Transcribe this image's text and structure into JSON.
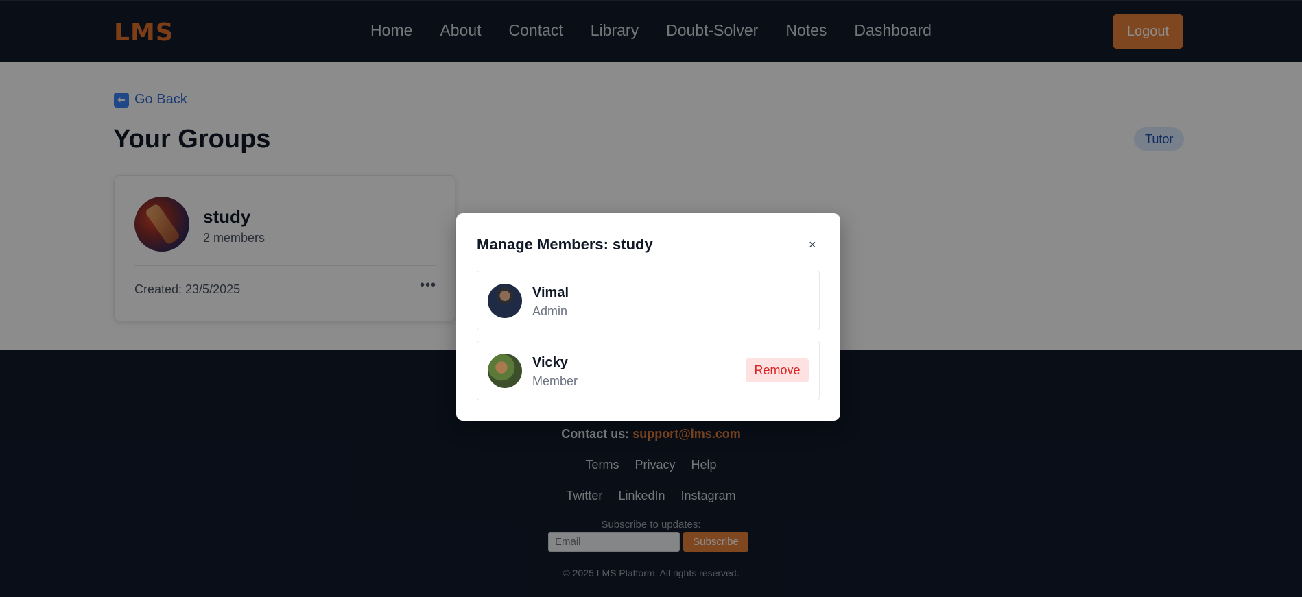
{
  "navbar": {
    "logo": "LMS",
    "links": [
      "Home",
      "About",
      "Contact",
      "Library",
      "Doubt-Solver",
      "Notes",
      "Dashboard"
    ],
    "logout_label": "Logout"
  },
  "main": {
    "back_label": "Go Back",
    "title": "Your Groups",
    "role_badge": "Tutor",
    "group": {
      "name": "study",
      "members": "2 members",
      "created": "Created: 23/5/2025",
      "more_label": "•••"
    }
  },
  "modal": {
    "title": "Manage Members: study",
    "close_label": "×",
    "members": [
      {
        "name": "Vimal",
        "role": "Admin"
      },
      {
        "name": "Vicky",
        "role": "Member",
        "action": "Remove"
      }
    ]
  },
  "footer": {
    "contact_prefix": "Contact us:",
    "contact_email": "support@lms.com",
    "links_1": [
      "Terms",
      "Privacy",
      "Help"
    ],
    "links_2": [
      "Twitter",
      "LinkedIn",
      "Instagram"
    ],
    "subscribe_label": "Subscribe to updates:",
    "email_placeholder": "Email",
    "subscribe_button": "Subscribe",
    "copyright": "© 2025 LMS Platform. All rights reserved."
  },
  "colors": {
    "accent": "#e8823a",
    "navbar_bg": "#121a2b",
    "link_blue": "#2f6bd1",
    "danger": "#dc2626"
  }
}
